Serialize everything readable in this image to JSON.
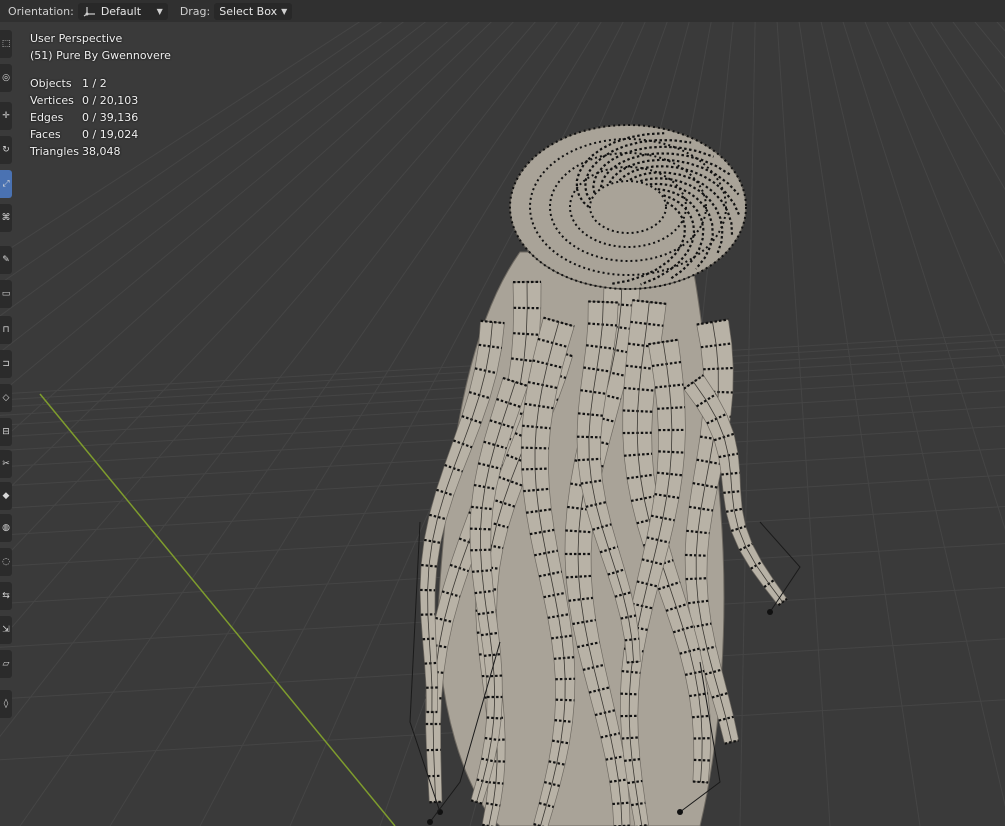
{
  "header": {
    "orientation_label": "Orientation:",
    "orientation_value": "Default",
    "drag_label": "Drag:",
    "drag_value": "Select Box"
  },
  "overlay": {
    "view_name": "User Perspective",
    "object_info": "(51) Pure By Gwennovere",
    "stats": [
      {
        "label": "Objects",
        "value": "1 / 2"
      },
      {
        "label": "Vertices",
        "value": "0 / 20,103"
      },
      {
        "label": "Edges",
        "value": "0 / 39,136"
      },
      {
        "label": "Faces",
        "value": "0 / 19,024"
      },
      {
        "label": "Triangles",
        "value": "38,048"
      }
    ]
  },
  "toolbar": {
    "tools": [
      {
        "icon": "select-box-icon",
        "active": false
      },
      {
        "icon": "cursor-icon",
        "active": false
      },
      {
        "icon": "move-icon",
        "active": false
      },
      {
        "icon": "rotate-icon",
        "active": false
      },
      {
        "icon": "scale-icon",
        "active": true
      },
      {
        "icon": "transform-icon",
        "active": false
      },
      {
        "icon": "annotate-icon",
        "active": false
      },
      {
        "icon": "measure-icon",
        "active": false
      },
      {
        "icon": "extrude-icon",
        "active": false
      },
      {
        "icon": "inset-icon",
        "active": false
      },
      {
        "icon": "bevel-icon",
        "active": false
      },
      {
        "icon": "loop-cut-icon",
        "active": false
      },
      {
        "icon": "knife-icon",
        "active": false
      },
      {
        "icon": "poly-build-icon",
        "active": false
      },
      {
        "icon": "spin-icon",
        "active": false
      },
      {
        "icon": "smooth-icon",
        "active": false
      },
      {
        "icon": "edge-slide-icon",
        "active": false
      },
      {
        "icon": "shrink-icon",
        "active": false
      },
      {
        "icon": "shear-icon",
        "active": false
      },
      {
        "icon": "rip-icon",
        "active": false
      }
    ]
  },
  "colors": {
    "viewport_bg": "#3a3a3a",
    "header_bg": "#303030",
    "active_tool": "#4a72b2",
    "grid_line": "#454545",
    "axis_y": "#7e9c2d",
    "mesh_surface": "#b8b2a6",
    "wire_vertex": "#111111"
  }
}
